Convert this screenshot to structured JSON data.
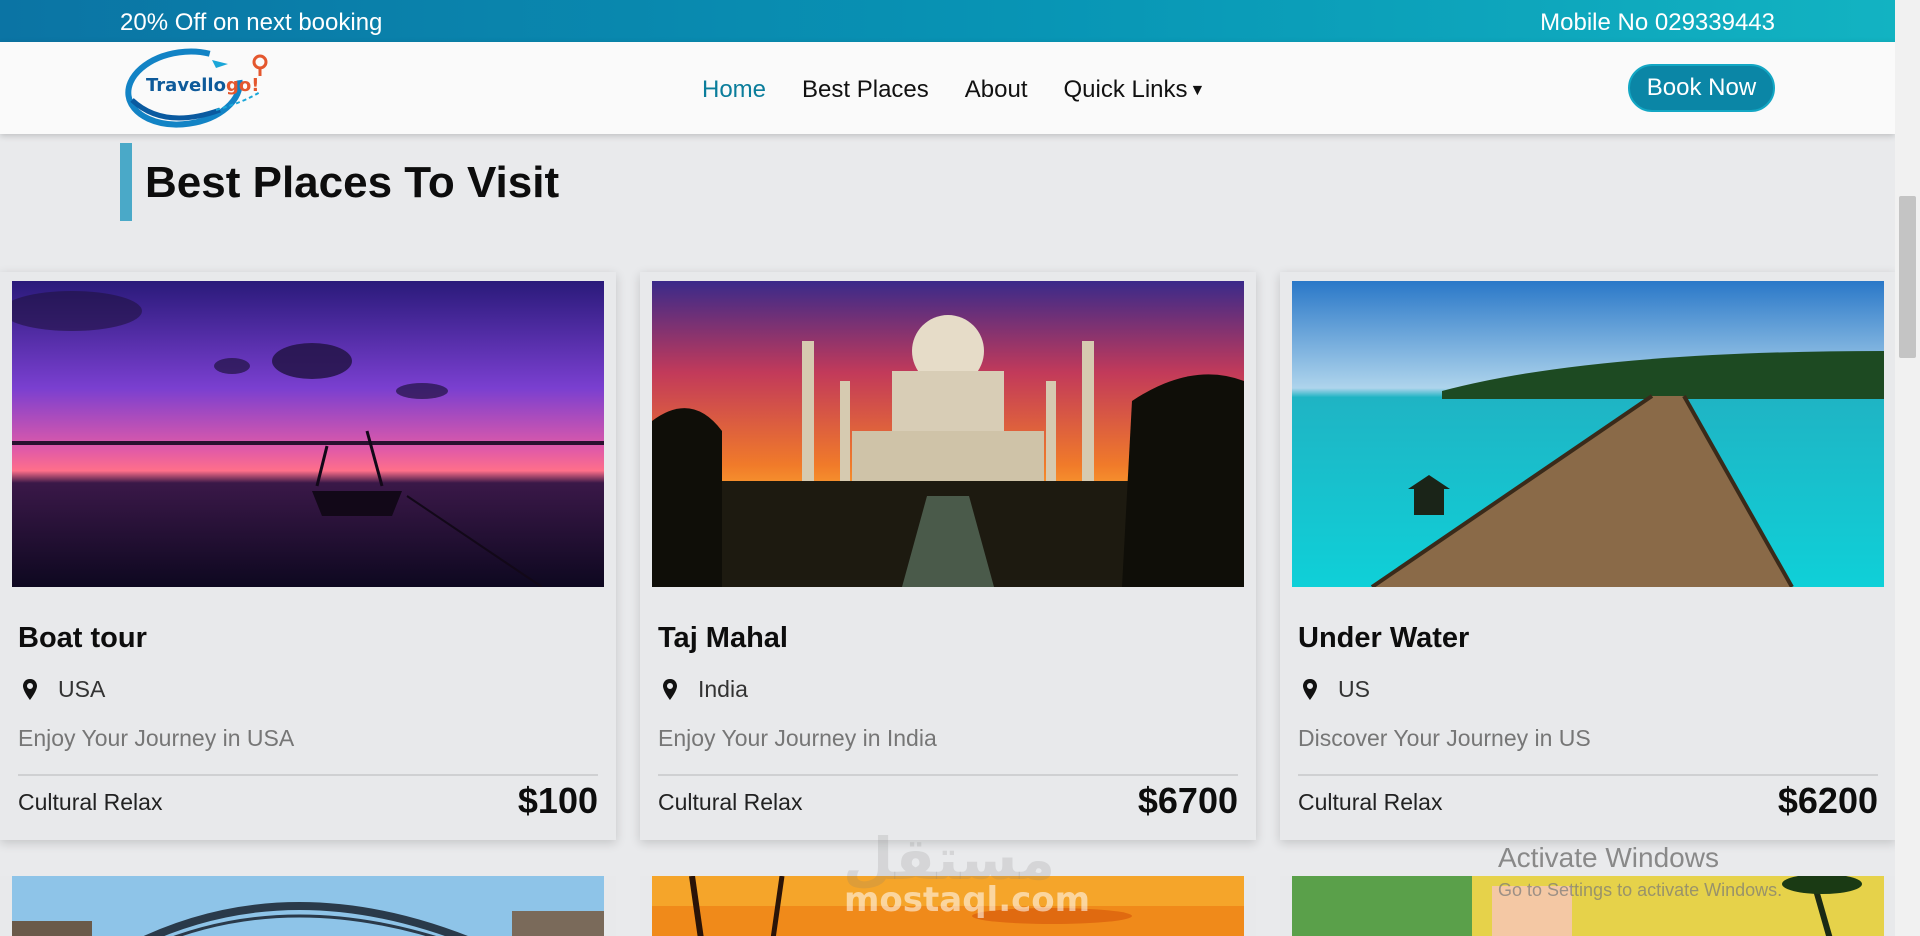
{
  "topbar": {
    "promo": "20% Off on next booking",
    "phone": "Mobile No 029339443"
  },
  "logo": {
    "text_main": "Travello",
    "text_accent": "go!"
  },
  "nav": {
    "links": [
      "Home",
      "Best Places",
      "About",
      "Quick Links"
    ],
    "active": "Home",
    "cta": "Book Now"
  },
  "section": {
    "title": "Best Places To Visit"
  },
  "cards": [
    {
      "name": "Boat tour",
      "location": "USA",
      "description": "Enjoy Your Journey in USA",
      "tag": "Cultural Relax",
      "price": "$100"
    },
    {
      "name": "Taj Mahal",
      "location": "India",
      "description": "Enjoy Your Journey in India",
      "tag": "Cultural Relax",
      "price": "$6700"
    },
    {
      "name": "Under Water",
      "location": "US",
      "description": "Discover Your Journey in US",
      "tag": "Cultural Relax",
      "price": "$6200"
    }
  ],
  "overlay": {
    "activate_title": "Activate Windows",
    "activate_sub": "Go to Settings to activate Windows.",
    "watermark_ar": "مستقل",
    "watermark_en": "mostaql.com"
  },
  "colors": {
    "topbar_start": "#0b74a4",
    "topbar_end": "#12b3c2",
    "accent": "#0a7d9b",
    "button": "#0b86a6",
    "title_bar": "#4aa9c8"
  },
  "icons": [
    "map-pin-icon",
    "caret-down-icon"
  ]
}
